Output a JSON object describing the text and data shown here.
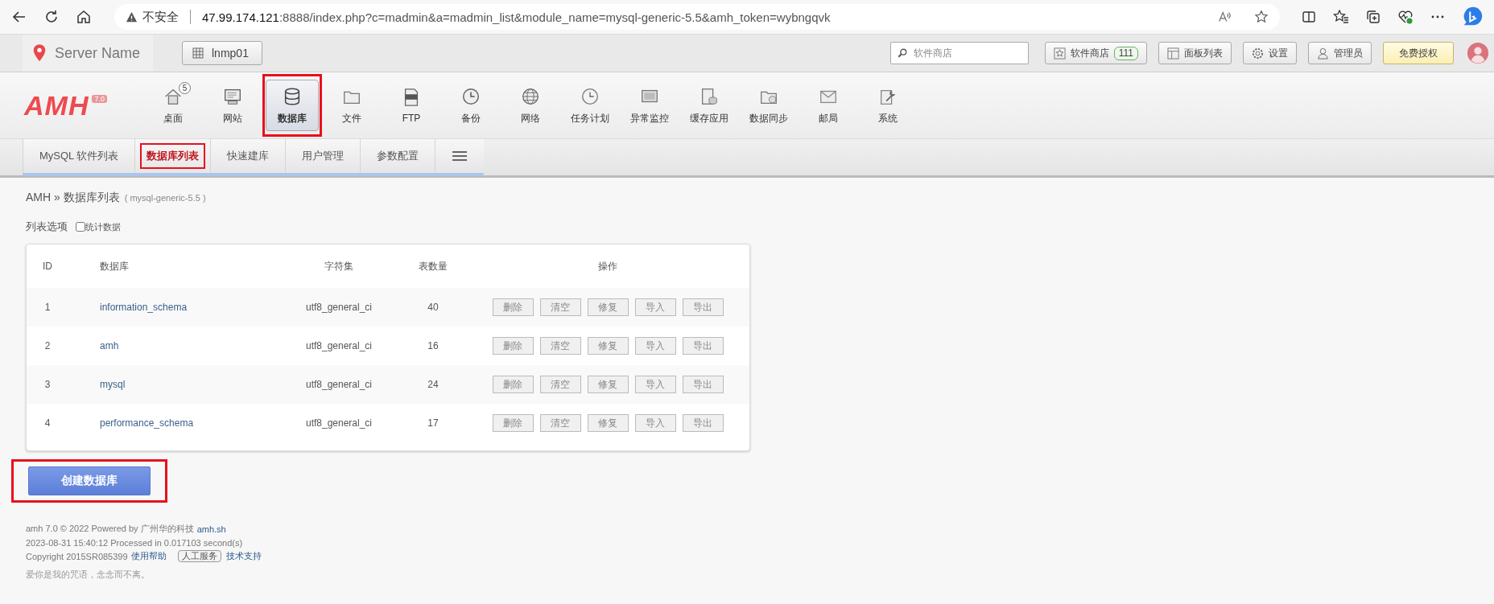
{
  "browser": {
    "security": "不安全",
    "url_host": "47.99.174.121",
    "url_path": ":8888/index.php?c=madmin&a=madmin_list&module_name=mysql-generic-5.5&amh_token=wybngqvk"
  },
  "header": {
    "server_name": "Server Name",
    "server_button": "lnmp01",
    "search": {
      "placeholder": "软件商店"
    },
    "buttons": [
      {
        "kind": "store",
        "label": "软件商店",
        "badge": "111"
      },
      {
        "kind": "panels",
        "label": "面板列表"
      },
      {
        "kind": "settings",
        "label": "设置"
      },
      {
        "kind": "admin",
        "label": "管理员"
      },
      {
        "kind": "license",
        "label": "免费授权"
      }
    ]
  },
  "nav": {
    "logo": "AMH",
    "version": "7.0",
    "items": [
      {
        "label": "桌面",
        "badge": "5",
        "selected": false,
        "highlighted": false
      },
      {
        "label": "网站",
        "selected": false,
        "highlighted": false
      },
      {
        "label": "数据库",
        "selected": true,
        "highlighted": true
      },
      {
        "label": "文件",
        "selected": false,
        "highlighted": false
      },
      {
        "label": "FTP",
        "selected": false,
        "highlighted": false
      },
      {
        "label": "备份",
        "selected": false,
        "highlighted": false
      },
      {
        "label": "网络",
        "selected": false,
        "highlighted": false
      },
      {
        "label": "任务计划",
        "selected": false,
        "highlighted": false
      },
      {
        "label": "异常监控",
        "selected": false,
        "highlighted": false
      },
      {
        "label": "缓存应用",
        "selected": false,
        "highlighted": false
      },
      {
        "label": "数据同步",
        "selected": false,
        "highlighted": false
      },
      {
        "label": "邮局",
        "selected": false,
        "highlighted": false
      },
      {
        "label": "系统",
        "selected": false,
        "highlighted": false
      }
    ]
  },
  "tabs": [
    {
      "label": "MySQL 软件列表",
      "selected": false,
      "highlighted": false
    },
    {
      "label": "数据库列表",
      "selected": true,
      "highlighted": true
    },
    {
      "label": "快速建库",
      "selected": false,
      "highlighted": false
    },
    {
      "label": "用户管理",
      "selected": false,
      "highlighted": false
    },
    {
      "label": "参数配置",
      "selected": false,
      "highlighted": false
    }
  ],
  "breadcrumb": {
    "path": "AMH » 数据库列表",
    "module": "( mysql-generic-5.5 )"
  },
  "list_options": {
    "label": "列表选项",
    "checkbox": {
      "label": "统计数据",
      "checked": false
    }
  },
  "table": {
    "columns": [
      "ID",
      "数据库",
      "字符集",
      "表数量",
      "操作"
    ],
    "rows": [
      {
        "id": "1",
        "name": "information_schema",
        "charset": "utf8_general_ci",
        "tables": "40",
        "actions": [
          "删除",
          "清空",
          "修复",
          "导入",
          "导出"
        ]
      },
      {
        "id": "2",
        "name": "amh",
        "charset": "utf8_general_ci",
        "tables": "16",
        "actions": [
          "删除",
          "清空",
          "修复",
          "导入",
          "导出"
        ]
      },
      {
        "id": "3",
        "name": "mysql",
        "charset": "utf8_general_ci",
        "tables": "24",
        "actions": [
          "删除",
          "清空",
          "修复",
          "导入",
          "导出"
        ]
      },
      {
        "id": "4",
        "name": "performance_schema",
        "charset": "utf8_general_ci",
        "tables": "17",
        "actions": [
          "删除",
          "清空",
          "修复",
          "导入",
          "导出"
        ]
      }
    ]
  },
  "create_button": {
    "label": "创建数据库",
    "highlighted": true
  },
  "footer": {
    "line1": "amh 7.0 © 2022 Powered by 广州华的科技",
    "line1_link": "amh.sh",
    "line2": "2023-08-31 15:40:12 Processed in 0.017103 second(s)",
    "line3": "Copyright 2015SR085399",
    "help_link": "使用帮助",
    "service_badge": "人工服务",
    "support_link": "技术支持",
    "slogan": "爱你是我的咒语，念念而不离。"
  }
}
